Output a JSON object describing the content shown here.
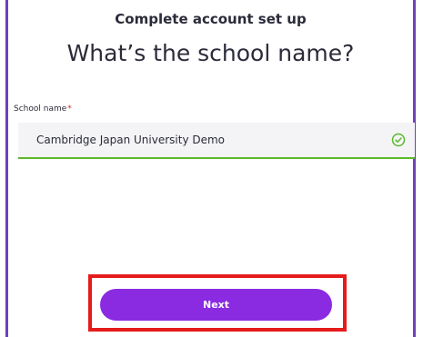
{
  "header": {
    "title": "Complete account set up"
  },
  "main": {
    "question": "What’s the school name?",
    "field": {
      "label": "School name",
      "required_mark": "*",
      "value": "Cambridge Japan University Demo",
      "status_icon": "check-circle-icon"
    },
    "next_button": {
      "label": "Next"
    }
  },
  "colors": {
    "accent_purple": "#8a2be2",
    "frame_purple": "#6f3fbf",
    "valid_green": "#5cb82d",
    "highlight_red": "#e41c1c"
  }
}
